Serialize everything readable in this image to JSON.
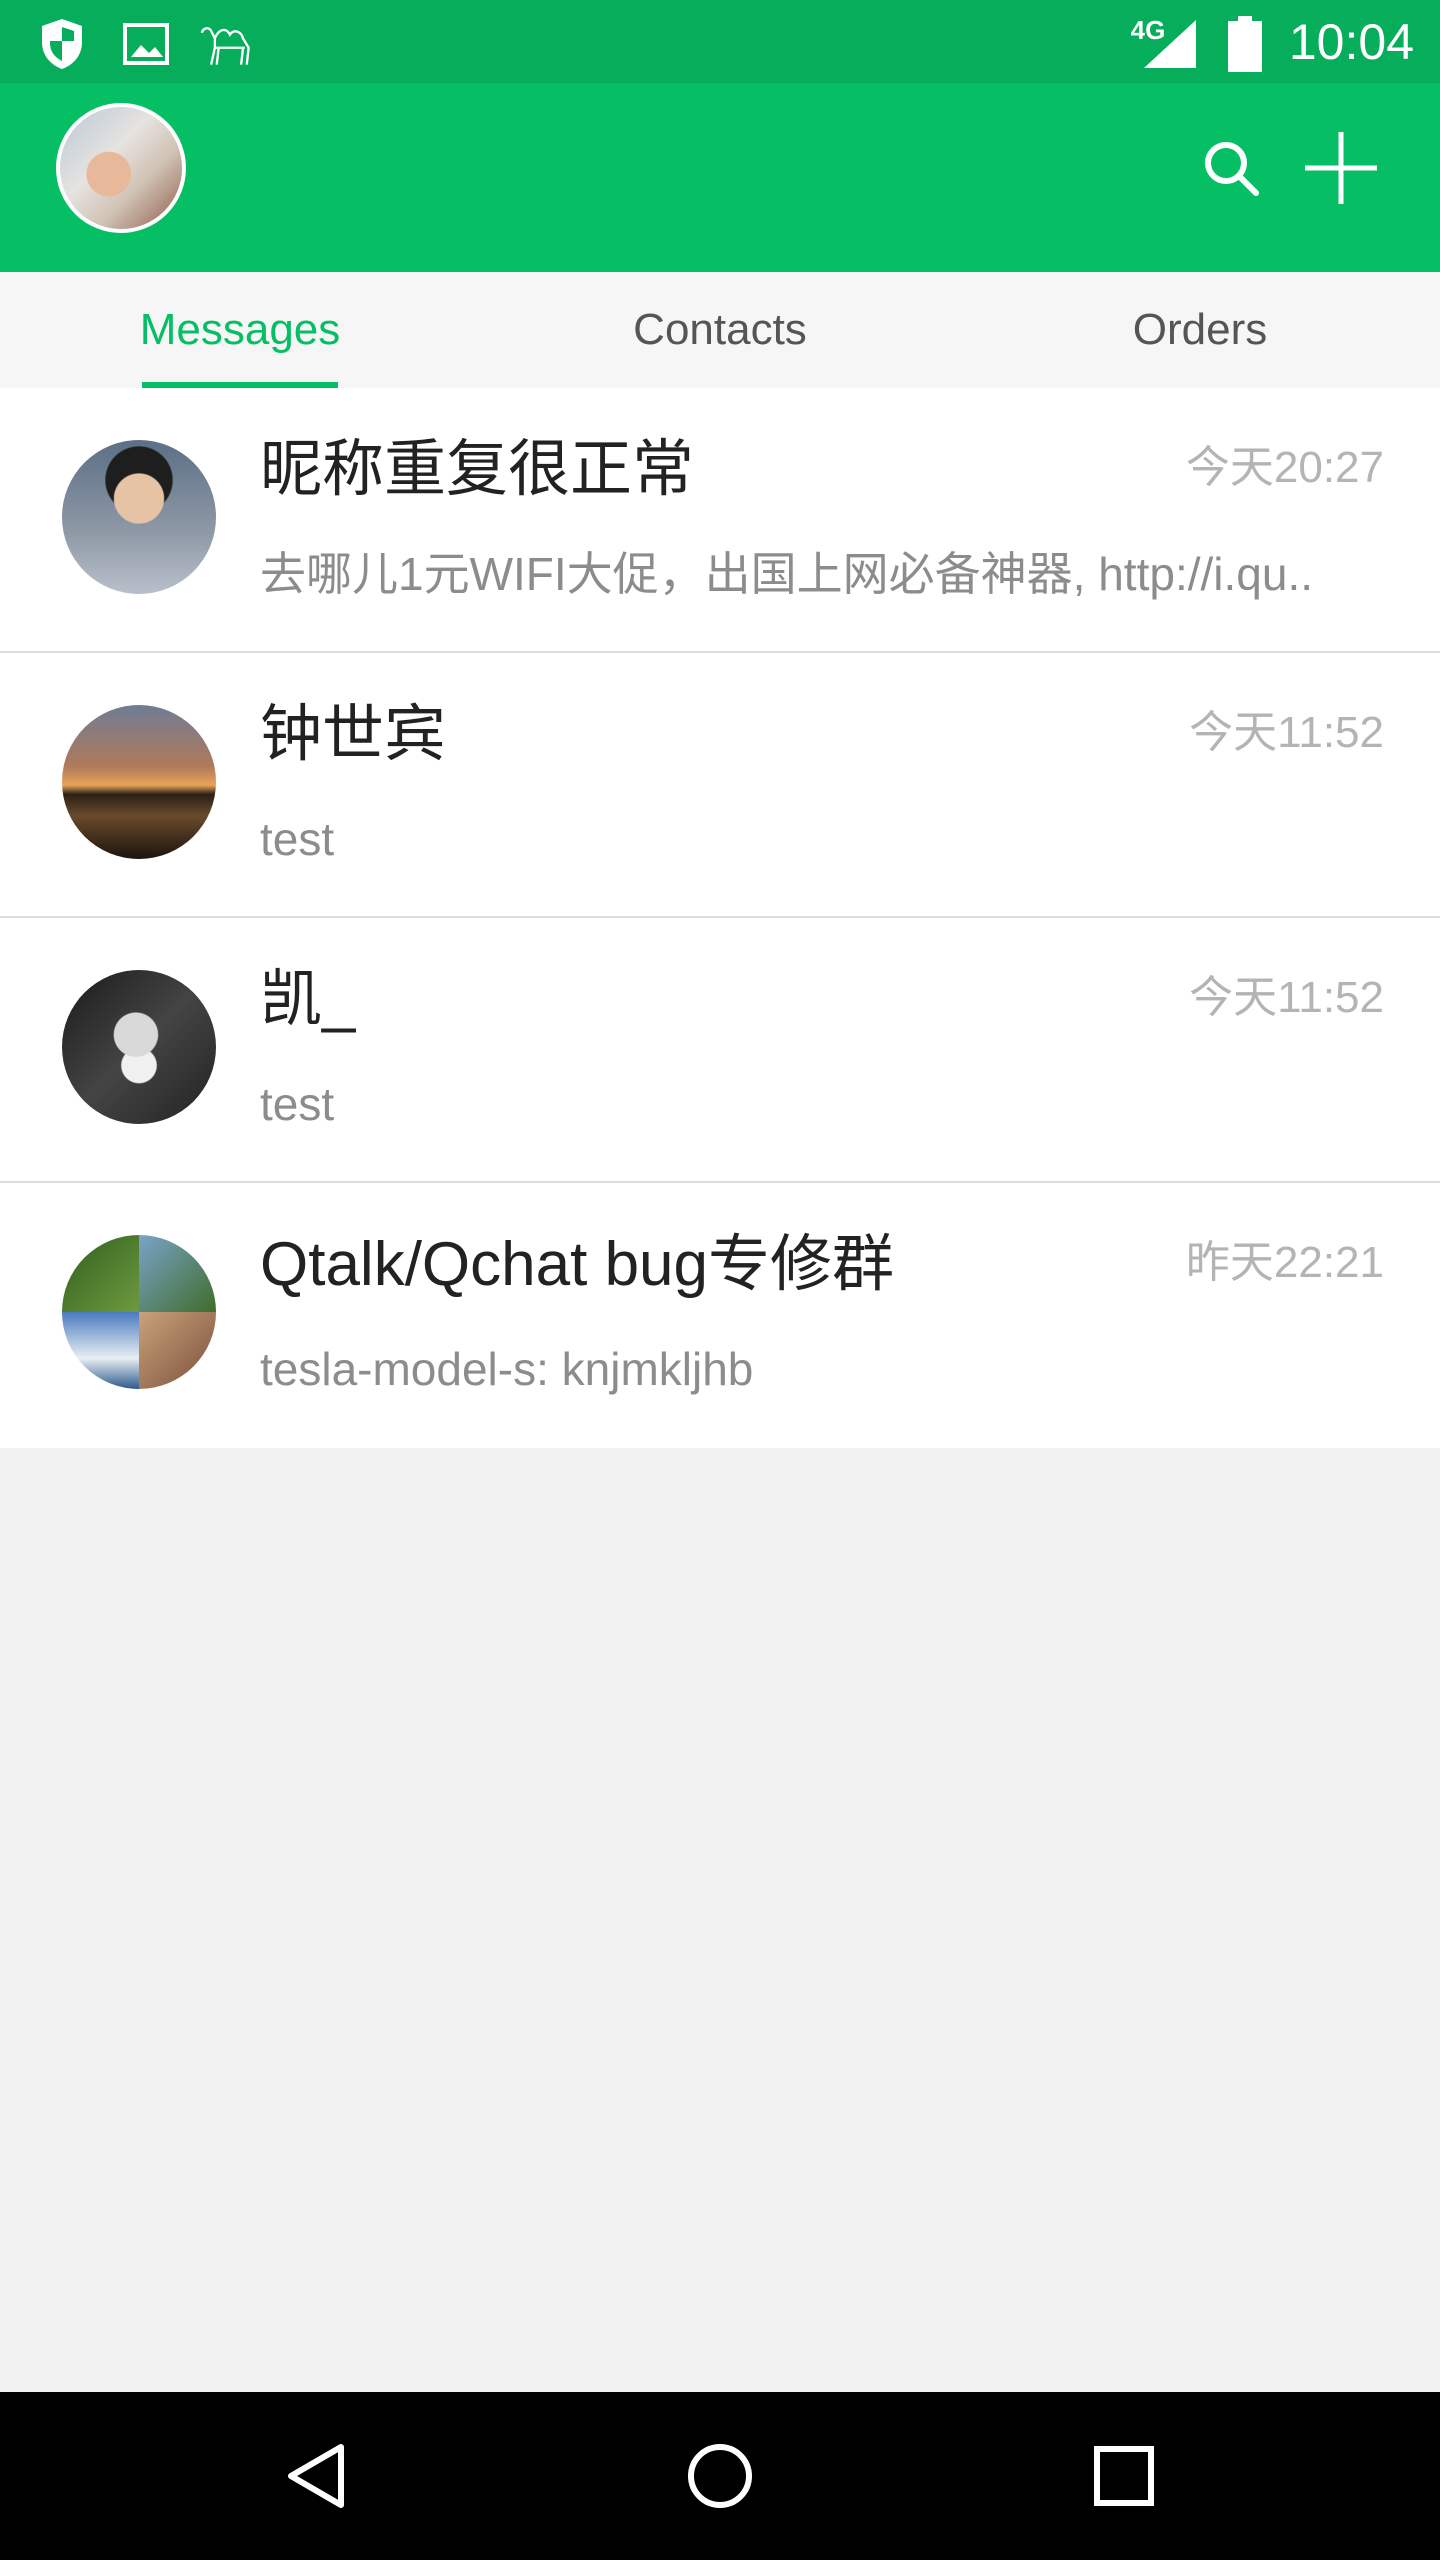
{
  "status_bar": {
    "time": "10:04",
    "network": "4G",
    "icons": [
      "shield-icon",
      "image-icon",
      "camel-icon",
      "signal-icon",
      "battery-icon"
    ]
  },
  "app_bar": {
    "profile_avatar": "profile-avatar",
    "actions": [
      "search-icon",
      "plus-icon"
    ]
  },
  "tabs": [
    {
      "label": "Messages",
      "active": true
    },
    {
      "label": "Contacts",
      "active": false
    },
    {
      "label": "Orders",
      "active": false
    }
  ],
  "conversations": [
    {
      "title": "昵称重复很正常",
      "time": "今天20:27",
      "preview": "去哪儿1元WIFI大促，出国上网必备神器, http://i.qu.."
    },
    {
      "title": "钟世宾",
      "time": "今天11:52",
      "preview": "test"
    },
    {
      "title": "凯_",
      "time": "今天11:52",
      "preview": "test"
    },
    {
      "title": "Qtalk/Qchat bug专修群",
      "time": "昨天22:21",
      "preview": "tesla-model-s: knjmkljhb"
    }
  ],
  "nav_bar": {
    "buttons": [
      "back-icon",
      "home-icon",
      "recents-icon"
    ]
  },
  "colors": {
    "accent": "#06bf65",
    "status_bar": "#06ad5a",
    "background": "#f2f2f2"
  }
}
